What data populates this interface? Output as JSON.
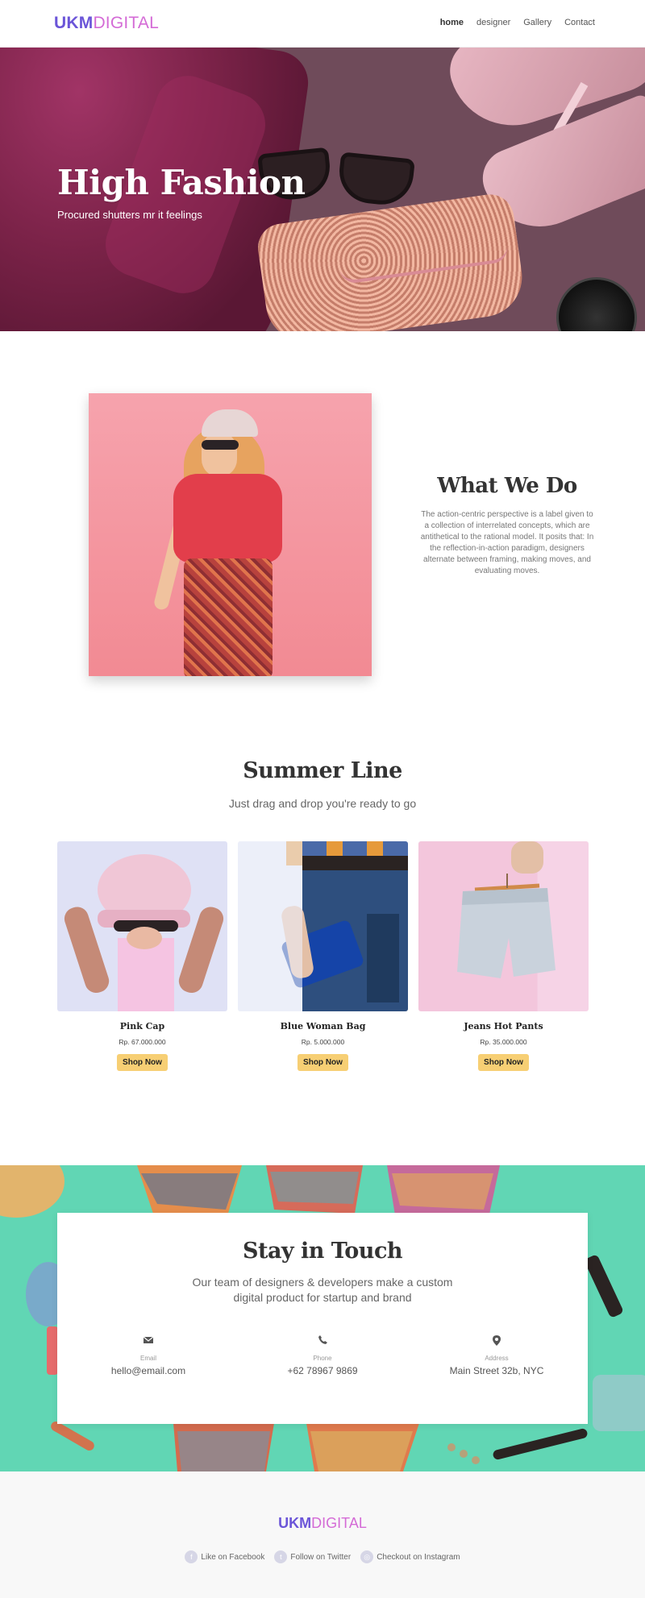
{
  "nav": {
    "logo": {
      "part1": "UKM",
      "part2": "DIGITAL"
    },
    "links": [
      "home",
      "designer",
      "Gallery",
      "Contact"
    ]
  },
  "hero": {
    "title": "High Fashion",
    "subtitle": "Procured shutters mr it feelings"
  },
  "what_we_do": {
    "title": "What We Do",
    "body": "The action-centric perspective is a label given to a collection of interrelated concepts, which are antithetical to the rational model. It posits that: In the reflection-in-action paradigm, designers alternate between framing, making moves, and evaluating moves."
  },
  "summer_line": {
    "title": "Summer Line",
    "subtitle": "Just drag and drop you're ready to go",
    "products": [
      {
        "name": "Pink Cap",
        "price": "Rp. 67.000.000",
        "button": "Shop Now"
      },
      {
        "name": "Blue Woman Bag",
        "price": "Rp. 5.000.000",
        "button": "Shop Now"
      },
      {
        "name": "Jeans Hot Pants",
        "price": "Rp. 35.000.000",
        "button": "Shop Now"
      }
    ]
  },
  "stay_in_touch": {
    "title": "Stay in Touch",
    "body_line1": "Our team of designers & developers make a custom",
    "body_line2": "digital product for startup and brand",
    "contacts": [
      {
        "icon": "envelope-icon",
        "label": "Email",
        "value": "hello@email.com"
      },
      {
        "icon": "phone-icon",
        "label": "Phone",
        "value": "+62 78967 9869"
      },
      {
        "icon": "map-marker-icon",
        "label": "Address",
        "value": "Main Street 32b, NYC"
      }
    ]
  },
  "footer": {
    "logo": {
      "part1": "UKM",
      "part2": "DIGITAL"
    },
    "links": [
      {
        "icon": "facebook-icon",
        "label": "Like on Facebook"
      },
      {
        "icon": "twitter-icon",
        "label": "Follow on Twitter"
      },
      {
        "icon": "instagram-icon",
        "label": "Checkout on Instagram"
      }
    ]
  },
  "colors": {
    "brand_purple": "#6b55d8",
    "brand_pink": "#d46bd6",
    "button_yellow": "#f7cf74",
    "teal_bg": "#61d6b4"
  }
}
